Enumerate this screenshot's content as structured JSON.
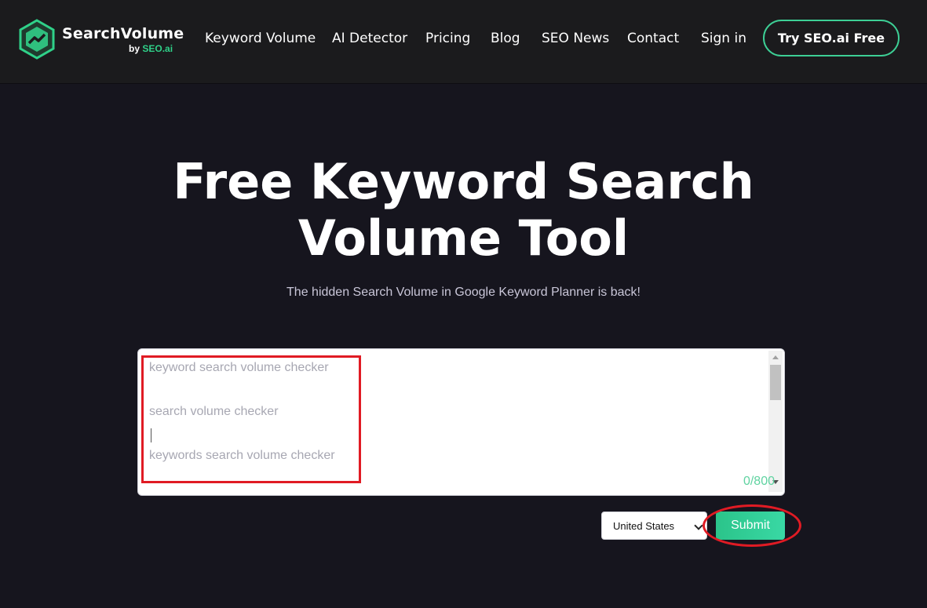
{
  "header": {
    "logo": {
      "title": "SearchVolume",
      "by": "by",
      "brand": "SEO.ai"
    },
    "nav": [
      {
        "label": "Keyword Volume"
      },
      {
        "label": "AI Detector"
      },
      {
        "label": "Pricing"
      },
      {
        "label": "Blog"
      },
      {
        "label": "SEO News"
      },
      {
        "label": "Contact"
      },
      {
        "label": "Sign in"
      }
    ],
    "cta_label": "Try SEO.ai Free"
  },
  "hero": {
    "title_line1": "Free Keyword Search",
    "title_line2": "Volume Tool",
    "subtitle": "The hidden Search Volume in Google Keyword Planner is back!"
  },
  "tool": {
    "placeholder_lines": [
      "keyword search volume checker",
      "",
      "search volume checker",
      "",
      "keywords search volume checker"
    ],
    "counter": "0/800",
    "country_selected": "United States",
    "submit_label": "Submit"
  },
  "colors": {
    "page_bg": "#16151e",
    "nav_bg": "#1b1b1d",
    "accent": "#2fd189",
    "highlight": "#e01b24"
  },
  "icons": {
    "logo": "search-volume-logo-icon",
    "select_arrow": "chevron-down-icon"
  }
}
